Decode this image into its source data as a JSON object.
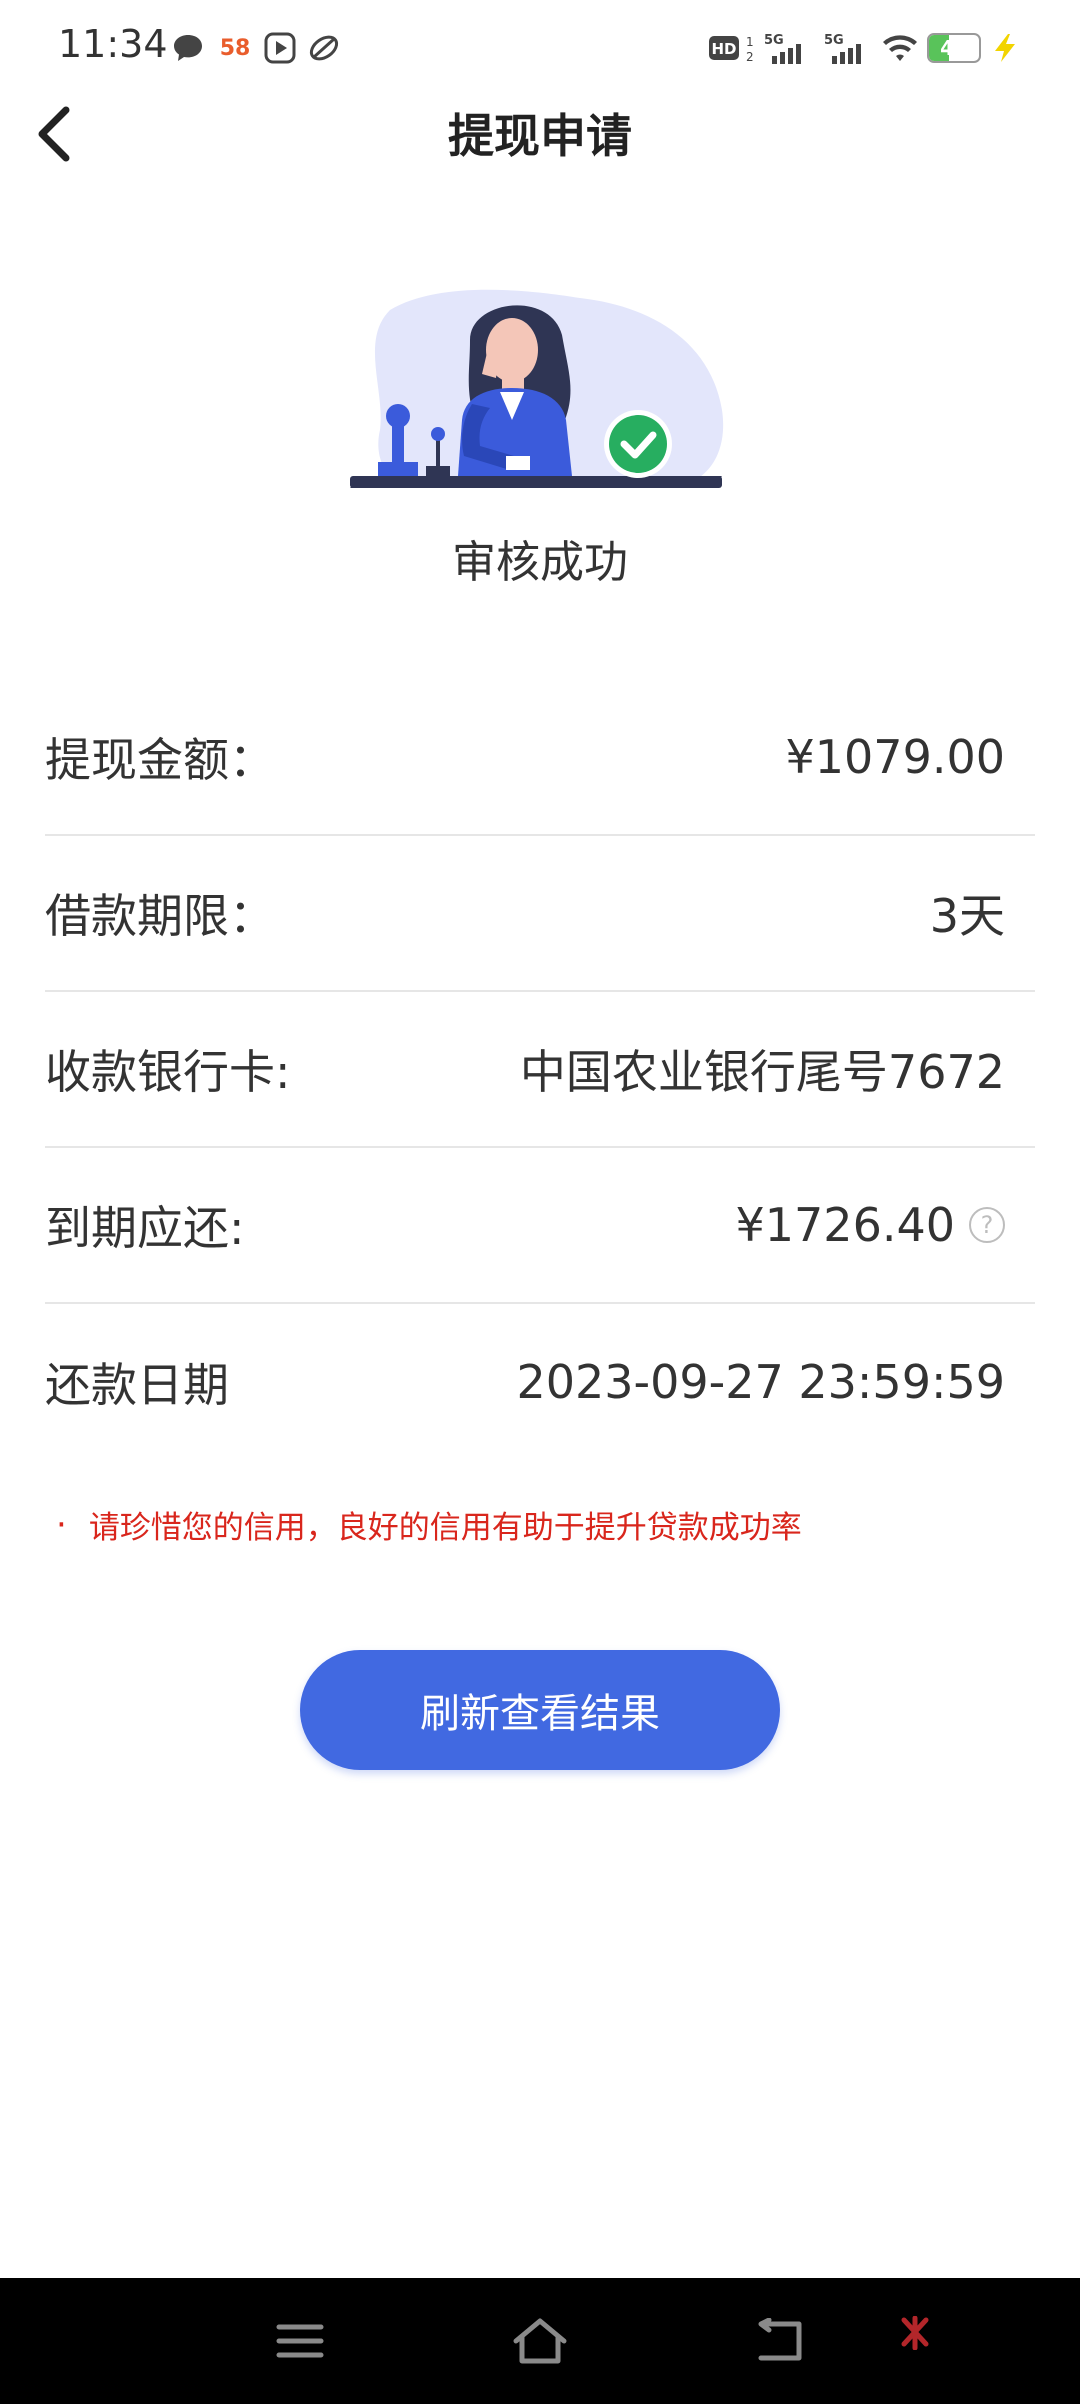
{
  "status_bar": {
    "time": "11:34",
    "network_1": "5G",
    "network_2": "5G",
    "battery_level": "40",
    "battery_percent": 40,
    "notification_58": "58"
  },
  "header": {
    "title": "提现申请"
  },
  "status": {
    "text": "审核成功"
  },
  "details": {
    "amount_label": "提现金额：",
    "amount_value": "¥1079.00",
    "term_label": "借款期限：",
    "term_value": "3天",
    "bank_label": "收款银行卡:",
    "bank_value": "中国农业银行尾号7672",
    "due_label": "到期应还:",
    "due_value": "¥1726.40",
    "repay_date_label": "还款日期",
    "repay_date_value": "2023-09-27 23:59:59"
  },
  "notice": {
    "bullet": "·",
    "text": "请珍惜您的信用，良好的信用有助于提升贷款成功率"
  },
  "refresh_button": {
    "label": "刷新查看结果"
  },
  "colors": {
    "primary": "#4169e1",
    "notice": "#d9261c",
    "success": "#27ae60",
    "battery": "#59c35a"
  }
}
